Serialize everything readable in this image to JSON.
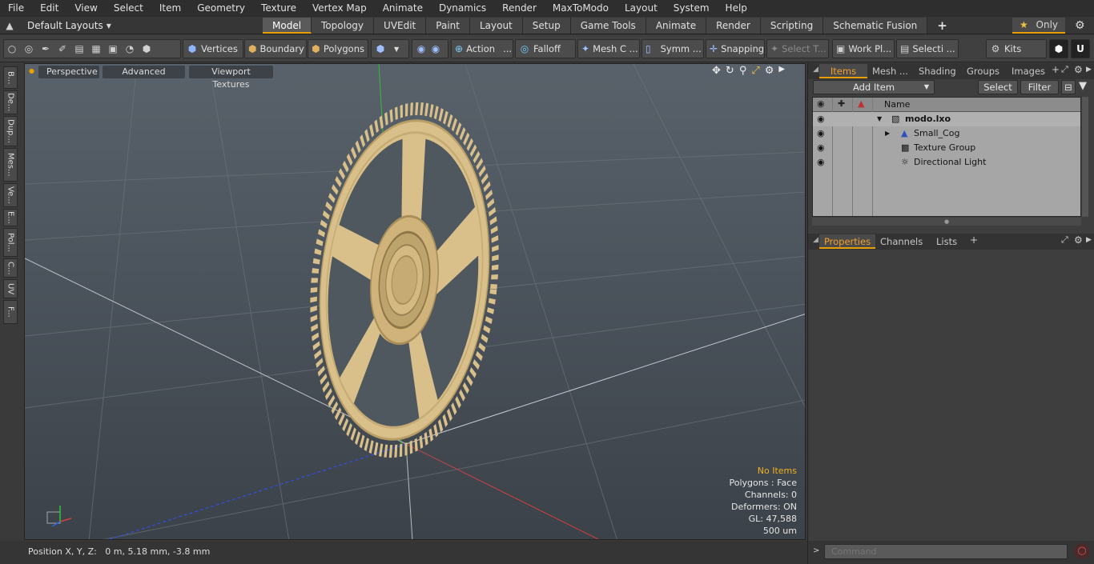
{
  "menu": [
    "File",
    "Edit",
    "View",
    "Select",
    "Item",
    "Geometry",
    "Texture",
    "Vertex Map",
    "Animate",
    "Dynamics",
    "Render",
    "MaxToModo",
    "Layout",
    "System",
    "Help"
  ],
  "layout_selector": "Default Layouts",
  "tabs": [
    "Model",
    "Topology",
    "UVEdit",
    "Paint",
    "Layout",
    "Setup",
    "Game Tools",
    "Animate",
    "Render",
    "Scripting",
    "Schematic Fusion"
  ],
  "active_tab": "Model",
  "only_label": "Only",
  "toolbar": {
    "vertices": "Vertices",
    "boundary": "Boundary",
    "polygons": "Polygons",
    "action": "Action",
    "falloff": "Falloff",
    "mesh": "Mesh C ...",
    "symm": "Symm ...",
    "snapping": "Snapping",
    "select_t": "Select T...",
    "work_pl": "Work Pl...",
    "selecti": "Selecti ...",
    "kits": "Kits"
  },
  "left_tabs": [
    "B...",
    "De...",
    "Dup...",
    "Mes...",
    "Ve...",
    "E...",
    "Pol...",
    "C...",
    "UV",
    "F..."
  ],
  "viewport": {
    "tabs": [
      "Perspective",
      "Advanced",
      "Viewport Textures"
    ],
    "info": {
      "no_items": "No Items",
      "polygons": "Polygons : Face",
      "channels": "Channels: 0",
      "deformers": "Deformers: ON",
      "gl": "GL: 47,588",
      "scale": "500 um"
    }
  },
  "status": {
    "position": "Position X, Y, Z:   0 m, 5.18 mm, -3.8 mm"
  },
  "right_panel": {
    "top_tabs": [
      "Items",
      "Mesh ...",
      "Shading",
      "Groups",
      "Images"
    ],
    "add_item": "Add Item",
    "select": "Select",
    "filter": "Filter",
    "name_col": "Name",
    "items": [
      {
        "name": "modo.lxo",
        "bold": true
      },
      {
        "name": "Small_Cog",
        "bold": false
      },
      {
        "name": "Texture Group",
        "bold": false
      },
      {
        "name": "Directional Light",
        "bold": false
      }
    ],
    "bottom_tabs": [
      "Properties",
      "Channels",
      "Lists"
    ],
    "command_placeholder": "Command"
  },
  "colors": {
    "accent": "#e8a000",
    "gear": "#d9c08a",
    "info_highlight": "#f0b020"
  }
}
